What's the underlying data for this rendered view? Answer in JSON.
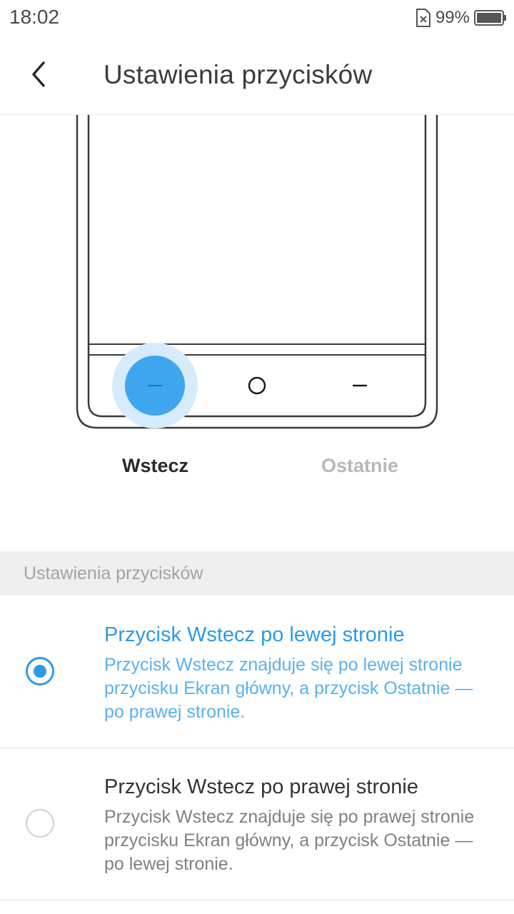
{
  "status_bar": {
    "time": "18:02",
    "battery_percent": "99%",
    "icons": [
      "no-sim-icon",
      "battery-icon"
    ]
  },
  "header": {
    "title": "Ustawienia przycisków",
    "back_icon": "chevron-left-icon"
  },
  "illustration": {
    "highlighted_button": "back",
    "nav_icons": [
      "back-dash-icon",
      "home-circle-icon",
      "recent-dash-icon"
    ],
    "accent_color": "#3ea6ef"
  },
  "tabs": [
    {
      "label": "Wstecz",
      "active": true
    },
    {
      "label": "Ostatnie",
      "active": false
    }
  ],
  "section": {
    "header": "Ustawienia przycisków"
  },
  "options": [
    {
      "title": "Przycisk Wstecz po lewej stronie",
      "description": "Przycisk Wstecz znajduje się po lewej stronie przycisku Ekran główny, a przycisk Ostatnie — po prawej stronie.",
      "selected": true
    },
    {
      "title": "Przycisk Wstecz po prawej stronie",
      "description": "Przycisk Wstecz znajduje się po prawej stronie przycisku Ekran główny, a przycisk Ostatnie — po lewej stronie.",
      "selected": false
    }
  ],
  "colors": {
    "accent": "#2d9ae6",
    "accent_light_text": "#5ab1ee",
    "title_text": "#3c3c3c",
    "secondary_text": "#808080",
    "section_bg": "#efefef"
  }
}
